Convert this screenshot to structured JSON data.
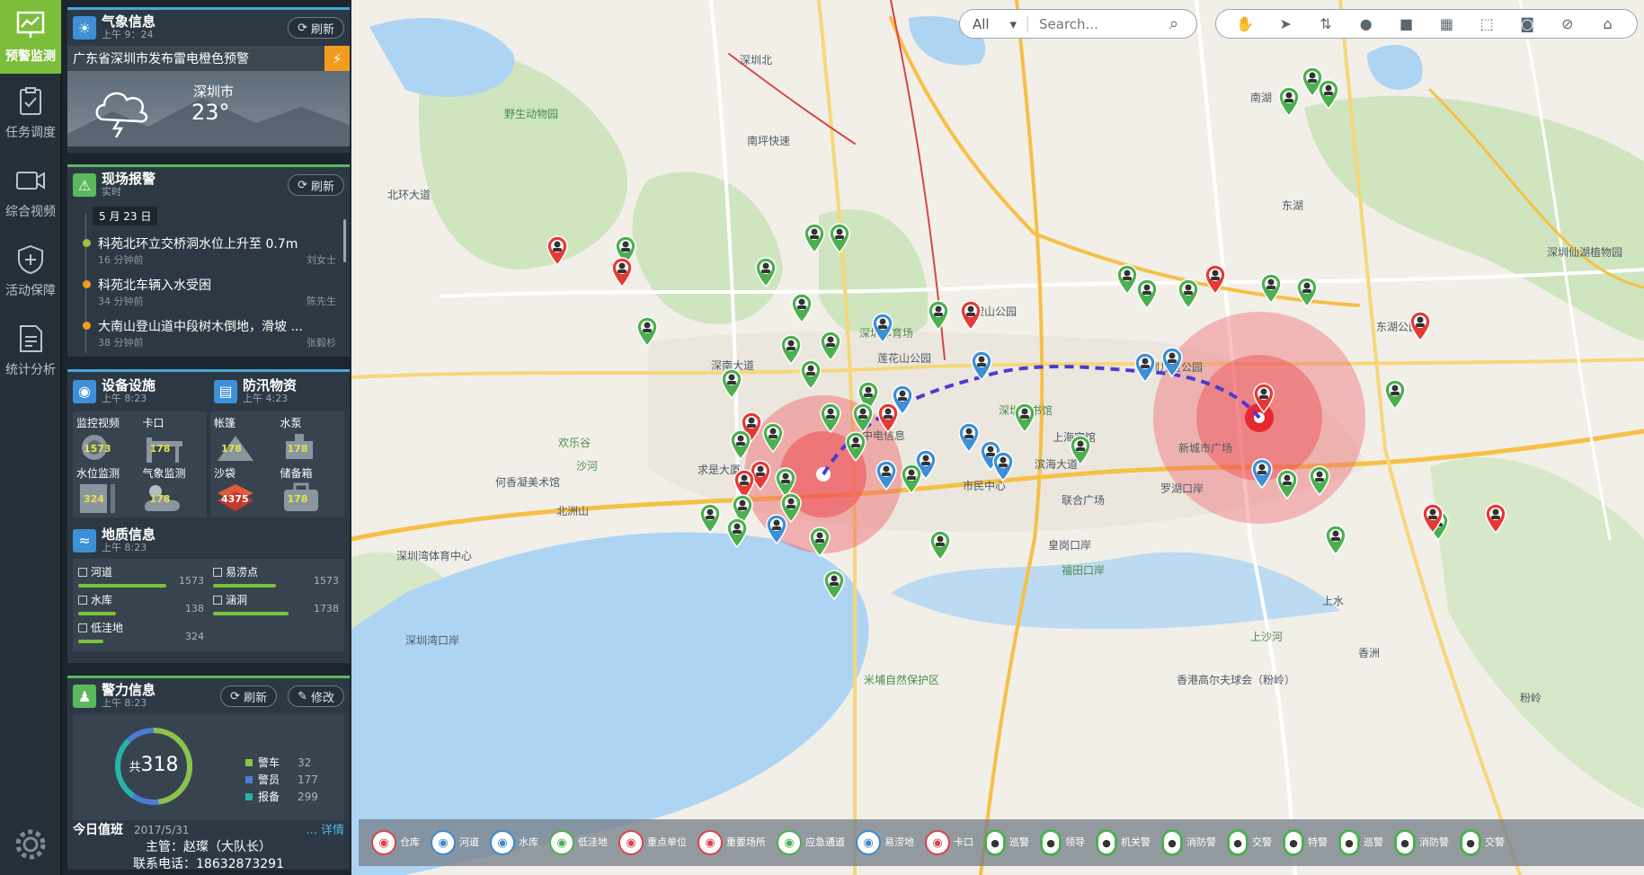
{
  "nav": {
    "items": [
      {
        "label": "预警监测",
        "icon": "chart-monitor-icon",
        "active": true
      },
      {
        "label": "任务调度",
        "icon": "clipboard-check-icon"
      },
      {
        "label": "综合视频",
        "icon": "video-camera-icon"
      },
      {
        "label": "活动保障",
        "icon": "shield-plus-icon"
      },
      {
        "label": "统计分析",
        "icon": "document-chart-icon"
      }
    ],
    "settings_icon": "gear-icon"
  },
  "weather": {
    "title": "气象信息",
    "time": "上午 9：24",
    "refresh": "刷新",
    "alert": "广东省深圳市发布雷电橙色预警",
    "city": "深圳市",
    "temp": "23°"
  },
  "report": {
    "title": "现场报警",
    "subtitle": "实时",
    "refresh": "刷新",
    "date": "5 月 23 日",
    "items": [
      {
        "text": "科苑北环立交桥洞水位上升至 0.7m",
        "ago": "16 分钟前",
        "who": "刘女士",
        "color": "#9dc13a"
      },
      {
        "text": "科苑北车辆入水受困",
        "ago": "34 分钟前",
        "who": "陈先生",
        "color": "#f29c1f"
      },
      {
        "text": "大南山登山道中段树木倒地，滑坡 ...",
        "ago": "38 分钟前",
        "who": "张毅杉",
        "color": "#f29c1f"
      }
    ]
  },
  "facilities": {
    "title": "设备设施",
    "time": "上午 8:23",
    "items": [
      {
        "label": "监控视频",
        "value": "1573"
      },
      {
        "label": "卡口",
        "value": "178"
      },
      {
        "label": "水位监测",
        "value": "324"
      },
      {
        "label": "气象监测",
        "value": "178"
      }
    ]
  },
  "supplies": {
    "title": "防汛物资",
    "time": "上午 4:23",
    "items": [
      {
        "label": "帐篷",
        "value": "178"
      },
      {
        "label": "水泵",
        "value": "178"
      },
      {
        "label": "沙袋",
        "value": "4375"
      },
      {
        "label": "储备箱",
        "value": "178"
      }
    ]
  },
  "geology": {
    "title": "地质信息",
    "time": "上午 8:23",
    "items": [
      {
        "label": "河道",
        "value": "1573",
        "fill": 0.7
      },
      {
        "label": "易涝点",
        "value": "1573",
        "fill": 0.5
      },
      {
        "label": "水库",
        "value": "138",
        "fill": 0.3
      },
      {
        "label": "涵洞",
        "value": "1738",
        "fill": 0.6
      },
      {
        "label": "低洼地",
        "value": "324",
        "fill": 0.2
      }
    ]
  },
  "police": {
    "title": "警力信息",
    "time": "上午 8:23",
    "refresh": "刷新",
    "edit": "修改",
    "total_prefix": "共",
    "total": "318",
    "legend": [
      {
        "label": "警车",
        "value": "32",
        "color": "#8bc34a"
      },
      {
        "label": "警员",
        "value": "177",
        "color": "#4b7bd8"
      },
      {
        "label": "报备",
        "value": "299",
        "color": "#28b3a8"
      }
    ],
    "duty_title": "今日值班",
    "duty_date": "2017/5/31",
    "duty_more": "... 详情",
    "chief": "主管：赵璨（大队长）",
    "phone": "联系电话：18632873291"
  },
  "toolbar": {
    "select": "All",
    "search_placeholder": "Search...",
    "tools": [
      "hand-icon",
      "pointer-icon",
      "route-icon",
      "circle-icon",
      "square-icon",
      "ruler-icon",
      "select-area-icon",
      "locate-icon",
      "clear-icon",
      "trash-icon"
    ]
  },
  "map_labels": [
    "野生动物园",
    "深圳北",
    "南坪快速",
    "北环大道",
    "莲花山公园",
    "深圳体育场",
    "笔架山公园",
    "深圳儿童公园",
    "东湖公园",
    "深圳仙湖植物园",
    "欢乐谷",
    "何香凝美术馆",
    "北洲山",
    "求是大厦",
    "中电信息",
    "深圳图书馆",
    "上海宾馆",
    "市民中心",
    "深圳湾体育中心",
    "深圳湾口岸",
    "福田口岸",
    "联合广场",
    "新城市广场",
    "罗湖口岸",
    "香港高尔夫球会（粉岭）",
    "米埔自然保护区",
    "东湖",
    "南湖",
    "深南大道",
    "滨海大道",
    "沙河",
    "皇岗口岸",
    "上水",
    "香洲",
    "粉岭",
    "上沙河"
  ],
  "legend_bar": [
    {
      "label": "仓库",
      "icon": "warehouse-icon",
      "color": "#d9434b"
    },
    {
      "label": "河道",
      "icon": "river-icon",
      "color": "#3f89c9"
    },
    {
      "label": "水库",
      "icon": "reservoir-icon",
      "color": "#3f89c9"
    },
    {
      "label": "低洼地",
      "icon": "lowland-icon",
      "color": "#4caf50"
    },
    {
      "label": "重点单位",
      "icon": "key-unit-icon",
      "color": "#d9434b"
    },
    {
      "label": "重要场所",
      "icon": "important-place-icon",
      "color": "#d9434b"
    },
    {
      "label": "应急通道",
      "icon": "emergency-channel-icon",
      "color": "#4caf50"
    },
    {
      "label": "易涝地",
      "icon": "flood-area-icon",
      "color": "#3f89c9"
    },
    {
      "label": "卡口",
      "icon": "checkpoint-icon",
      "color": "#d9434b"
    },
    {
      "label": "巡警",
      "icon": "patrol-police-icon",
      "color": "#4caf50"
    },
    {
      "label": "领导",
      "icon": "leader-icon",
      "color": "#4caf50"
    },
    {
      "label": "机关警",
      "icon": "office-police-icon",
      "color": "#4caf50"
    },
    {
      "label": "消防警",
      "icon": "fire-police-icon",
      "color": "#4caf50"
    },
    {
      "label": "交警",
      "icon": "traffic-police-icon",
      "color": "#4caf50"
    },
    {
      "label": "特警",
      "icon": "special-police-icon",
      "color": "#4caf50"
    },
    {
      "label": "巡警",
      "icon": "patrol-police-icon",
      "color": "#4caf50"
    },
    {
      "label": "消防警",
      "icon": "fire-police-icon",
      "color": "#4caf50"
    },
    {
      "label": "交警",
      "icon": "traffic-police-icon",
      "color": "#4caf50"
    }
  ]
}
